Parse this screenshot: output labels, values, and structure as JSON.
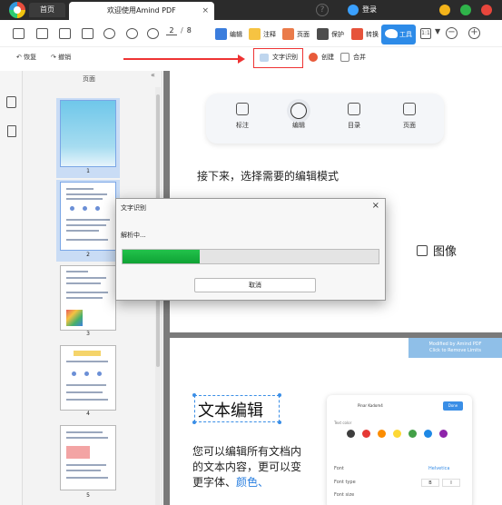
{
  "app": {
    "home_tab": "首页",
    "doc_tab": "欢迎使用Amind PDF",
    "close_glyph": "×",
    "help_glyph": "?",
    "login_label": "登录"
  },
  "toolbar": {
    "page_current": "2",
    "page_sep": "/",
    "page_total": "8",
    "modes": {
      "edit": "编辑",
      "annotate": "注释",
      "page": "页面",
      "protect": "保护",
      "convert": "转换",
      "tools": "工具"
    },
    "zoom_fit_glyph": "1:1",
    "caret_glyph": "▼",
    "zoom_out_glyph": "−",
    "zoom_in_glyph": "+"
  },
  "subtoolbar": {
    "redo": "恢复",
    "undo": "撤销",
    "ocr": "文字识别",
    "create": "创建",
    "merge": "合并"
  },
  "thumbnails": {
    "title": "页面",
    "collapse_glyph": "«",
    "pages": [
      "1",
      "2",
      "3",
      "4",
      "5"
    ],
    "selected": [
      1,
      2
    ]
  },
  "document": {
    "mode_panel": {
      "annotate": "标注",
      "edit": "编辑",
      "outline": "目录",
      "page": "页面"
    },
    "step_text": "接下来，选择需要的编辑模式",
    "image_label": "图像",
    "banner_line1": "Modified by Amind PDF",
    "banner_line2": "Click to Remove Limits",
    "edit_heading": "文本编辑",
    "edit_body_1": "您可以编辑所有文档内的文本内容，更可以变更",
    "edit_body_2": "字体、",
    "edit_body_3": "颜色、",
    "color_panel": {
      "font_label": "Pinar Kadom4",
      "done": "Done",
      "color_label": "Text color",
      "colors": [
        "#3d3d3d",
        "#e53935",
        "#fb8c00",
        "#fdd835",
        "#43a047",
        "#1e88e5",
        "#8e24aa"
      ],
      "font_row": "Font",
      "font_value": "Helvetica",
      "type_row": "Font type",
      "size_row": "Font size",
      "seg_bold": "B",
      "seg_italic": "I"
    }
  },
  "dialog": {
    "title": "文字识别",
    "close_glyph": "×",
    "message": "解析中...",
    "progress": 0.3,
    "cancel": "取消"
  }
}
